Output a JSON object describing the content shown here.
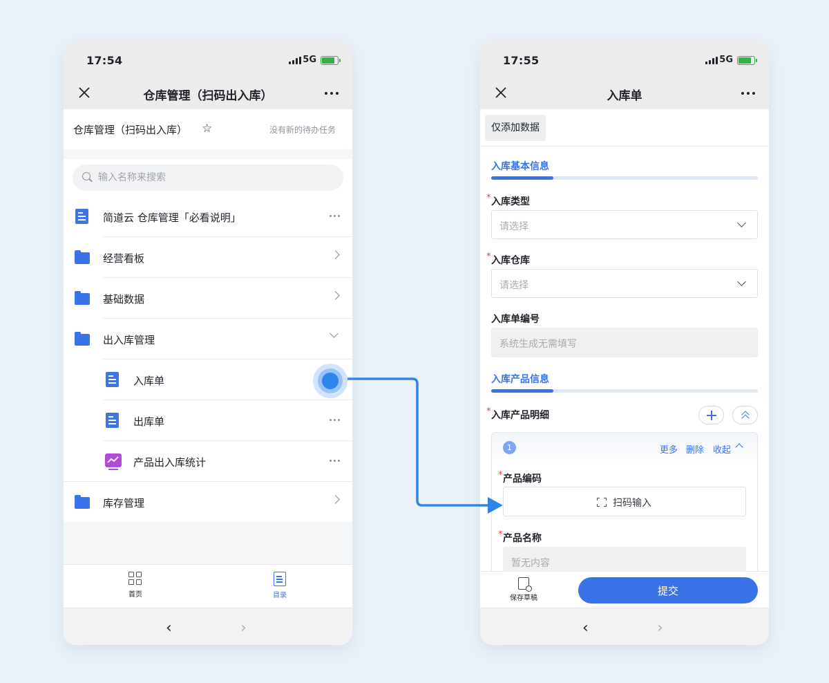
{
  "left_phone": {
    "status": {
      "time": "17:54",
      "network": "5G"
    },
    "navbar": {
      "title": "仓库管理（扫码出入库）",
      "close_icon": "close-icon",
      "more_icon": "more-icon"
    },
    "app_header": {
      "name": "仓库管理（扫码出入库）",
      "star_icon": "star-icon",
      "todo_text": "没有新的待办任务"
    },
    "search": {
      "placeholder": "输入名称来搜索"
    },
    "items": [
      {
        "label": "简道云 仓库管理「必看说明」",
        "icon": "document-icon",
        "trailing": "more"
      },
      {
        "label": "经营看板",
        "icon": "folder-icon",
        "trailing": "chevron-right"
      },
      {
        "label": "基础数据",
        "icon": "folder-icon",
        "trailing": "chevron-right"
      },
      {
        "label": "出入库管理",
        "icon": "folder-open-icon",
        "trailing": "chevron-down"
      },
      {
        "label": "入库单",
        "icon": "form-icon",
        "trailing": "highlight"
      },
      {
        "label": "出库单",
        "icon": "form-icon",
        "trailing": "more"
      },
      {
        "label": "产品出入库统计",
        "icon": "dashboard-icon",
        "trailing": "more"
      },
      {
        "label": "库存管理",
        "icon": "folder-icon",
        "trailing": "chevron-right"
      }
    ],
    "tabs": [
      {
        "label": "首页",
        "icon": "grid-icon",
        "active": false
      },
      {
        "label": "目录",
        "icon": "catalog-icon",
        "active": true
      }
    ]
  },
  "right_phone": {
    "status": {
      "time": "17:55",
      "network": "5G"
    },
    "navbar": {
      "title": "入库单",
      "close_icon": "close-icon",
      "more_icon": "more-icon"
    },
    "only_add_button": "仅添加数据",
    "sections": [
      {
        "title": "入库基本信息"
      },
      {
        "title": "入库产品信息"
      }
    ],
    "fields": {
      "type": {
        "label": "入库类型",
        "required": true,
        "placeholder": "请选择"
      },
      "warehouse": {
        "label": "入库仓库",
        "required": true,
        "placeholder": "请选择"
      },
      "number": {
        "label": "入库单编号",
        "required": false,
        "placeholder": "系统生成无需填写"
      },
      "detail": {
        "label": "入库产品明细",
        "required": true
      }
    },
    "detail_card": {
      "index": "1",
      "actions": {
        "more": "更多",
        "delete": "删除",
        "collapse": "收起"
      },
      "product_code": {
        "label": "产品编码",
        "required": true,
        "button": "扫码输入"
      },
      "product_name": {
        "label": "产品名称",
        "required": true,
        "placeholder": "暂无内容"
      }
    },
    "actions": {
      "save_draft": "保存草稿",
      "submit": "提交"
    }
  },
  "colors": {
    "accent": "#3a73e8",
    "highlight": "#2e86ea",
    "required": "#e94040",
    "page_bg": "#eaf1f9"
  },
  "required_mark": "*"
}
